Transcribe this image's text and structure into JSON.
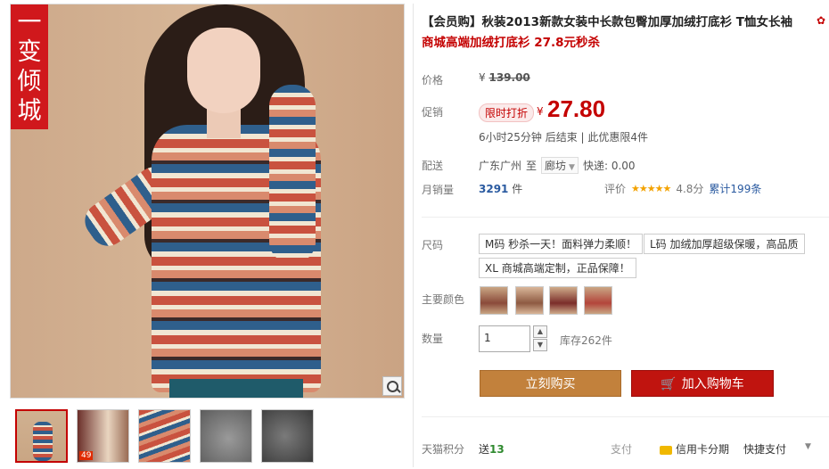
{
  "gallery": {
    "brand_tag": "一变倾城",
    "thumbnails": [
      "model-front",
      "outfit-pair",
      "fabric-stripe",
      "fleece-lining-1",
      "fleece-lining-2"
    ]
  },
  "product": {
    "title": "【会员购】秋装2013新款女装中长款包臀加厚加绒打底衫 T恤女长袖",
    "subtitle": "商城高端加绒打底衫 27.8元秒杀"
  },
  "price": {
    "label": "价格",
    "currency": "¥",
    "original": "139.00"
  },
  "promo": {
    "label": "促销",
    "badge": "限时打折",
    "currency": "¥",
    "price": "27.80",
    "countdown": "6小时25分钟 后结束 | 此优惠限4件"
  },
  "shipping": {
    "label": "配送",
    "from": "广东广州",
    "to_word": "至",
    "destination": "廊坊",
    "fee": "快递: 0.00"
  },
  "sales": {
    "label": "月销量",
    "count": "3291",
    "unit": "件"
  },
  "rating": {
    "label": "评价",
    "stars": "★★★★★",
    "score": "4.8分",
    "total_reviews": "累计199条"
  },
  "size": {
    "label": "尺码",
    "options": [
      "M码 秒杀一天！面料弹力柔顺！",
      "L码 加绒加厚超级保暖，高品质",
      "XL 商城高端定制，正品保障！"
    ]
  },
  "color": {
    "label": "主要颜色"
  },
  "quantity": {
    "label": "数量",
    "value": "1",
    "stock": "库存262件"
  },
  "actions": {
    "buy_now": "立刻购买",
    "add_to_cart": "加入购物车"
  },
  "footer": {
    "points_label": "天猫积分",
    "points_text": "送",
    "points_value": "13",
    "pay_label": "支付",
    "card_pay": "信用卡分期",
    "quick_pay": "快捷支付"
  },
  "colors": {
    "accent_red": "#c40000",
    "buy_button": "#c2813c",
    "cart_button": "#c0140f"
  }
}
